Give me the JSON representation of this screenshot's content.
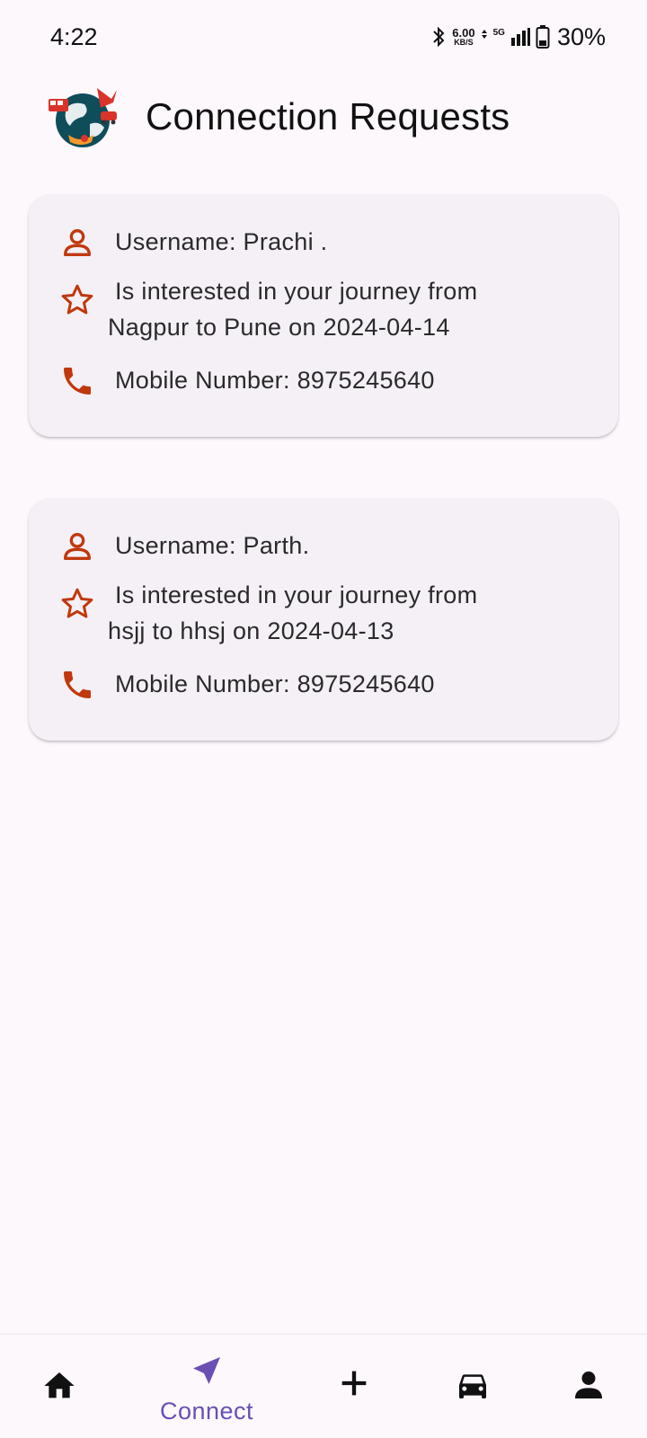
{
  "status_bar": {
    "time": "4:22",
    "net_speed_value": "6.00",
    "net_speed_unit": "KB/S",
    "network_type": "5G",
    "battery": "30%"
  },
  "header": {
    "title": "Connection Requests"
  },
  "requests": [
    {
      "username": "Username: Prachi .",
      "interest_line1": "Is interested in your journey from",
      "interest_line2": "Nagpur  to Pune on 2024-04-14",
      "mobile": "Mobile Number: 8975245640"
    },
    {
      "username": "Username: Parth.",
      "interest_line1": "Is interested in your journey from",
      "interest_line2": "hsjj to hhsj on 2024-04-13",
      "mobile": "Mobile Number: 8975245640"
    }
  ],
  "bottom_nav": {
    "connect_label": "Connect"
  },
  "colors": {
    "accent_icon": "#c0380c",
    "nav_active": "#6b4fb4",
    "card_bg": "#f4f0f6",
    "page_bg": "#fcf8fc"
  }
}
